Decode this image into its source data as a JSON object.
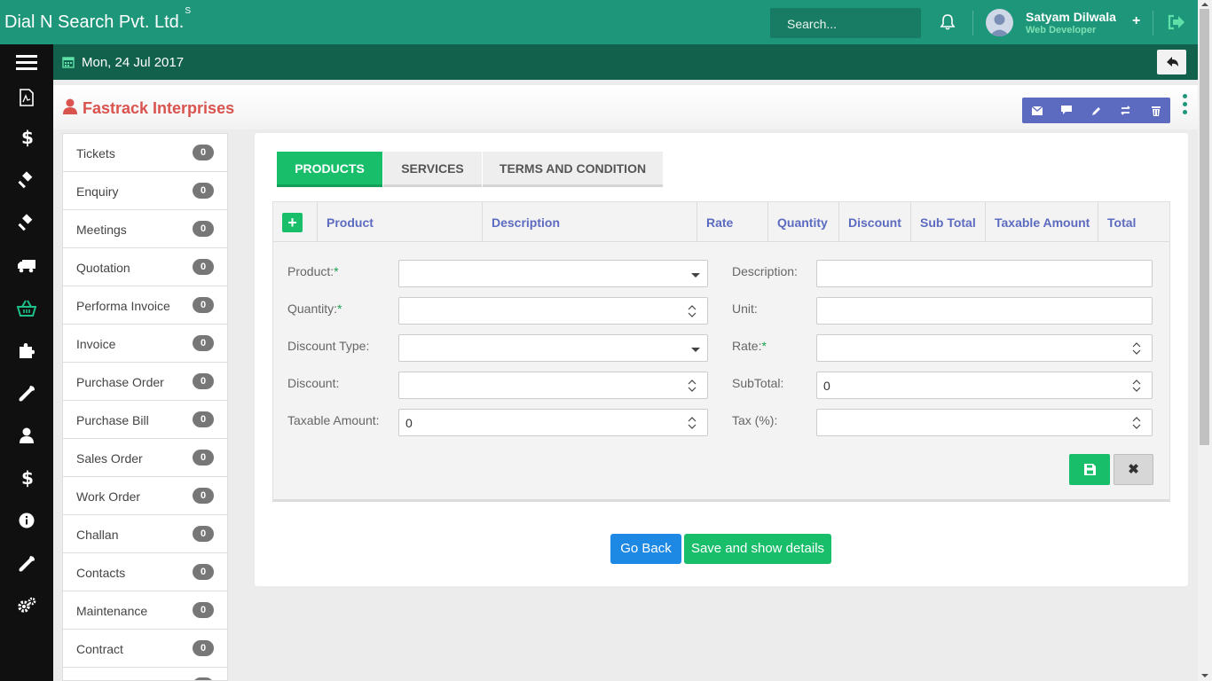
{
  "app": {
    "brand": "Dial N Search Pvt. Ltd.",
    "brand_sup": "S",
    "search_label": "Search...",
    "user_name": "Satyam Dilwala",
    "user_role": "Web Developer",
    "add_label": "+"
  },
  "datebar": {
    "date": "Mon, 24 Jul 2017"
  },
  "page": {
    "title": "Fastrack Interprises"
  },
  "side_list": [
    {
      "label": "Tickets",
      "count": "0"
    },
    {
      "label": "Enquiry",
      "count": "0"
    },
    {
      "label": "Meetings",
      "count": "0"
    },
    {
      "label": "Quotation",
      "count": "0"
    },
    {
      "label": "Performa Invoice",
      "count": "0"
    },
    {
      "label": "Invoice",
      "count": "0"
    },
    {
      "label": "Purchase Order",
      "count": "0"
    },
    {
      "label": "Purchase Bill",
      "count": "0"
    },
    {
      "label": "Sales Order",
      "count": "0"
    },
    {
      "label": "Work Order",
      "count": "0"
    },
    {
      "label": "Challan",
      "count": "0"
    },
    {
      "label": "Contacts",
      "count": "0"
    },
    {
      "label": "Maintenance",
      "count": "0"
    },
    {
      "label": "Contract",
      "count": "0"
    }
  ],
  "tabs": [
    {
      "label": "PRODUCTS"
    },
    {
      "label": "SERVICES"
    },
    {
      "label": "TERMS AND CONDITION"
    }
  ],
  "table": {
    "add_label": "+",
    "columns": [
      "Product",
      "Description",
      "Rate",
      "Quantity",
      "Discount",
      "Sub Total",
      "Taxable Amount",
      "Total"
    ]
  },
  "form": {
    "product_label": "Product:",
    "quantity_label": "Quantity:",
    "discount_type_label": "Discount Type:",
    "discount_label": "Discount:",
    "taxable_label": "Taxable Amount:",
    "taxable_value": "0",
    "description_label": "Description:",
    "unit_label": "Unit:",
    "rate_label": "Rate:",
    "subtotal_label": "SubTotal:",
    "subtotal_value": "0",
    "tax_label": "Tax (%):",
    "required_mark": "*",
    "close_label": "✖"
  },
  "buttons": {
    "go_back": "Go Back",
    "save_show": "Save and show details"
  },
  "colors": {
    "topbar": "#1e967a",
    "datebar": "#11614c",
    "accent_green": "#19be6b",
    "link_blue": "#5c6bc0",
    "title_red": "#d9534f"
  },
  "icons": [
    "bell-icon",
    "avatar",
    "logout-icon",
    "calendar-icon",
    "reply-icon",
    "user-icon",
    "envelope-icon",
    "comment-icon",
    "pencil-icon",
    "refresh-icon",
    "trash-icon",
    "save-icon"
  ]
}
